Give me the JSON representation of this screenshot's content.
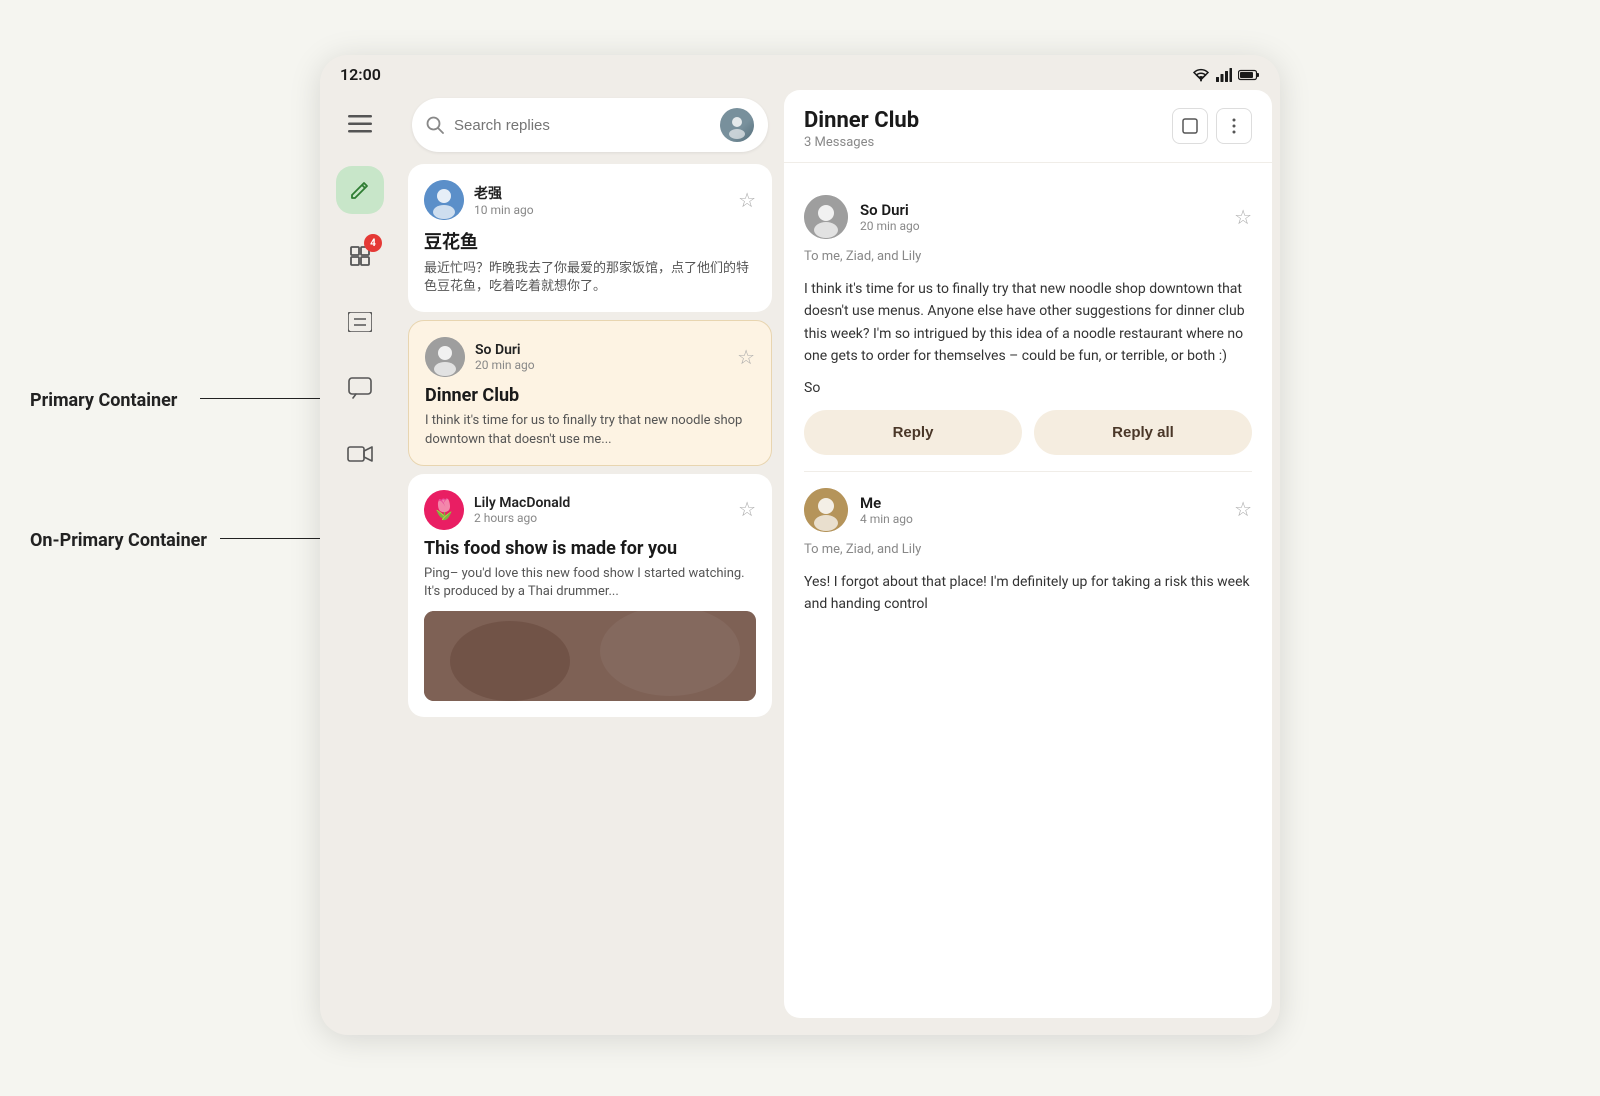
{
  "statusBar": {
    "time": "12:00",
    "icons": [
      "wifi",
      "signal",
      "battery"
    ]
  },
  "sidebar": {
    "icons": [
      {
        "name": "menu",
        "symbol": "☰",
        "active": false
      },
      {
        "name": "compose",
        "symbol": "✏",
        "active": true
      },
      {
        "name": "notifications",
        "symbol": "🖼",
        "active": false,
        "badge": "4"
      },
      {
        "name": "list",
        "symbol": "☰",
        "active": false
      },
      {
        "name": "chat",
        "symbol": "□",
        "active": false
      },
      {
        "name": "video",
        "symbol": "▷",
        "active": false
      }
    ]
  },
  "searchBar": {
    "placeholder": "Search replies",
    "icon": "search"
  },
  "emailList": {
    "emails": [
      {
        "id": "1",
        "sender": "老强",
        "time": "10 min ago",
        "subject": "豆花鱼",
        "preview": "最近忙吗？昨晚我去了你最爱的那家饭馆，点了他们的特色豆花鱼，吃着吃着就想你了。",
        "starred": false,
        "selected": false,
        "avatarClass": "av-laozhi"
      },
      {
        "id": "2",
        "sender": "So Duri",
        "time": "20 min ago",
        "subject": "Dinner Club",
        "preview": "I think it's time for us to finally try that new noodle shop downtown that doesn't use me...",
        "starred": false,
        "selected": true,
        "avatarClass": "av-soduri"
      },
      {
        "id": "3",
        "sender": "Lily MacDonald",
        "time": "2 hours ago",
        "subject": "This food show is made for you",
        "preview": "Ping– you'd love this new food show I started watching. It's produced by a Thai drummer...",
        "starred": false,
        "selected": false,
        "avatarClass": "av-lily",
        "hasImage": true
      }
    ]
  },
  "emailDetail": {
    "title": "Dinner Club",
    "messageCount": "3 Messages",
    "actions": [
      "square",
      "more"
    ],
    "messages": [
      {
        "id": "msg1",
        "sender": "So Duri",
        "time": "20 min ago",
        "recipients": "To me, Ziad, and Lily",
        "body": "I think it's time for us to finally try that new noodle shop downtown that doesn't use menus. Anyone else have other suggestions for dinner club this week? I'm so intrigued by this idea of a noodle restaurant where no one gets to order for themselves – could be fun, or terrible, or both :)",
        "sign": "So",
        "avatarClass": "av-soduri",
        "showReplyBtns": true
      },
      {
        "id": "msg2",
        "sender": "Me",
        "time": "4 min ago",
        "recipients": "To me, Ziad, and Lily",
        "body": "Yes! I forgot about that place! I'm definitely up for taking a risk this week and handing control",
        "sign": "",
        "avatarClass": "av-me",
        "showReplyBtns": false,
        "partial": true
      }
    ],
    "replyLabel": "Reply",
    "replyAllLabel": "Reply all"
  },
  "annotations": {
    "primaryContainer": "Primary Container",
    "onPrimaryContainer": "On-Primary Container"
  }
}
